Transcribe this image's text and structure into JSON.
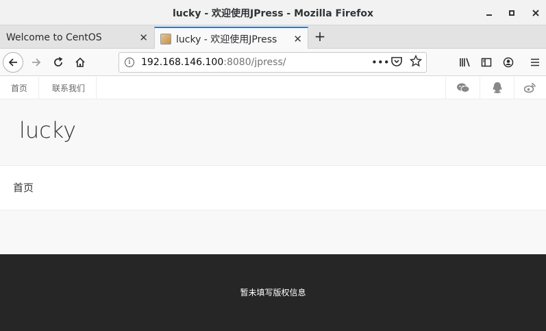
{
  "window": {
    "title": "lucky - 欢迎使用JPress - Mozilla Firefox"
  },
  "tabs": [
    {
      "label": "Welcome to CentOS"
    },
    {
      "label": "lucky - 欢迎使用JPress"
    }
  ],
  "url": {
    "host": "192.168.146.100",
    "rest": ":8080/jpress/"
  },
  "site": {
    "topnav": [
      "首页",
      "联系我们"
    ],
    "logo": "lucky",
    "menu": [
      "首页"
    ],
    "footer": "暂未填写版权信息"
  }
}
